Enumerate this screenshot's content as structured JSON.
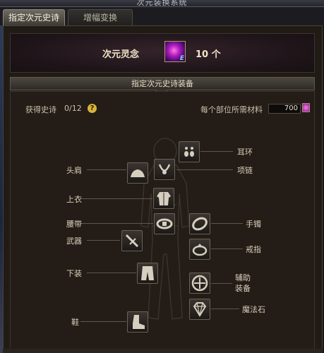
{
  "window": {
    "title": "次元装换系统"
  },
  "tabs": [
    {
      "label": "指定次元史诗",
      "active": true
    },
    {
      "label": "增幅变换",
      "active": false
    }
  ],
  "currency": {
    "name": "次元灵念",
    "icon": "dimension-orb-icon",
    "icon_badge": "E",
    "count": "10 个"
  },
  "section": {
    "title": "指定次元史诗装备"
  },
  "stats": {
    "obtained_label": "获得史诗",
    "obtained_value": "0/12",
    "help_symbol": "?",
    "material_label": "每个部位所需材料",
    "material_value": "700"
  },
  "slots": {
    "earring": "耳环",
    "necklace": "项链",
    "shoulder": "头肩",
    "top": "上衣",
    "belt": "腰带",
    "bracelet": "手镯",
    "weapon": "武器",
    "ring": "戒指",
    "pants": "下装",
    "support": "辅助\n装备",
    "magic_stone": "魔法石",
    "shoes": "鞋"
  },
  "colors": {
    "accent": "#d9b43a",
    "orb": "#b01cc0",
    "text": "#d8cfb8"
  }
}
